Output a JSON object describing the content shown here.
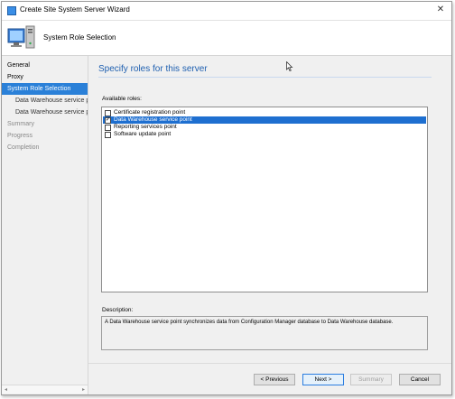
{
  "window": {
    "title": "Create Site System Server Wizard",
    "close_glyph": "✕"
  },
  "header": {
    "title": "System Role Selection",
    "icon": "server-computer-icon"
  },
  "sidebar": {
    "items": [
      {
        "label": "General"
      },
      {
        "label": "Proxy"
      },
      {
        "label": "System Role Selection"
      },
      {
        "label": "Data Warehouse service p"
      },
      {
        "label": "Data Warehouse service p"
      },
      {
        "label": "Summary"
      },
      {
        "label": "Progress"
      },
      {
        "label": "Completion"
      }
    ]
  },
  "main": {
    "section_title": "Specify roles for this server",
    "roles_label": "Available roles:",
    "roles": [
      {
        "label": "Certificate registration point",
        "checked": false
      },
      {
        "label": "Data Warehouse service point",
        "checked": true
      },
      {
        "label": "Reporting services point",
        "checked": false
      },
      {
        "label": "Software update point",
        "checked": false
      }
    ],
    "description_label": "Description:",
    "description": "A Data Warehouse service point synchronizes data from Configuration Manager database to Data Warehouse database."
  },
  "footer": {
    "previous": "< Previous",
    "next": "Next >",
    "summary": "Summary",
    "cancel": "Cancel"
  },
  "scroll": {
    "left": "◂",
    "right": "▸"
  }
}
